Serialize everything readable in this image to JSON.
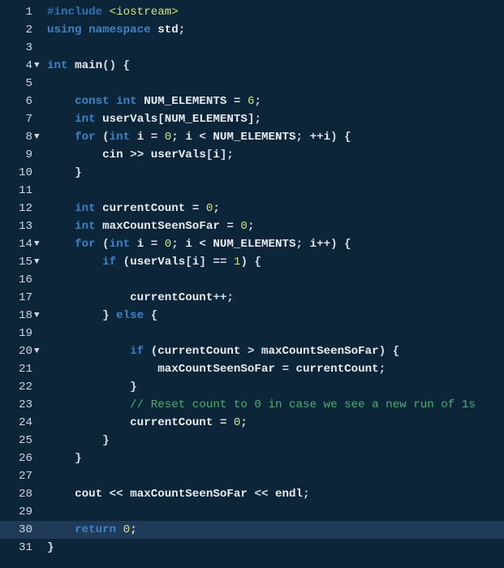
{
  "total_lines": 31,
  "fold_lines": [
    4,
    8,
    14,
    15,
    18,
    20
  ],
  "highlighted_line": 30,
  "lines": {
    "1": {
      "tokens": [
        [
          "pre",
          "#include "
        ],
        [
          "angle",
          "<iostream>"
        ]
      ]
    },
    "2": {
      "tokens": [
        [
          "kw",
          "using "
        ],
        [
          "kw",
          "namespace "
        ],
        [
          "std",
          "std"
        ],
        [
          "punc",
          ";"
        ]
      ]
    },
    "3": {
      "tokens": []
    },
    "4": {
      "tokens": [
        [
          "type",
          "int "
        ],
        [
          "id",
          "main"
        ],
        [
          "punc",
          "() "
        ],
        [
          "punc",
          "{"
        ]
      ]
    },
    "5": {
      "tokens": []
    },
    "6": {
      "tokens": [
        [
          "idn",
          "    "
        ],
        [
          "kw",
          "const "
        ],
        [
          "type",
          "int "
        ],
        [
          "id",
          "NUM_ELEMENTS"
        ],
        [
          "op",
          " = "
        ],
        [
          "num",
          "6"
        ],
        [
          "punc",
          ";"
        ]
      ]
    },
    "7": {
      "tokens": [
        [
          "idn",
          "    "
        ],
        [
          "type",
          "int "
        ],
        [
          "id",
          "userVals"
        ],
        [
          "punc",
          "["
        ],
        [
          "id",
          "NUM_ELEMENTS"
        ],
        [
          "punc",
          "];"
        ]
      ]
    },
    "8": {
      "tokens": [
        [
          "idn",
          "    "
        ],
        [
          "kw",
          "for "
        ],
        [
          "punc",
          "("
        ],
        [
          "type",
          "int "
        ],
        [
          "id",
          "i"
        ],
        [
          "op",
          " = "
        ],
        [
          "num",
          "0"
        ],
        [
          "punc",
          "; "
        ],
        [
          "id",
          "i"
        ],
        [
          "op",
          " < "
        ],
        [
          "id",
          "NUM_ELEMENTS"
        ],
        [
          "punc",
          "; "
        ],
        [
          "op",
          "++"
        ],
        [
          "id",
          "i"
        ],
        [
          "punc",
          ") {"
        ]
      ]
    },
    "9": {
      "tokens": [
        [
          "idn",
          "        "
        ],
        [
          "id",
          "cin"
        ],
        [
          "op",
          " >> "
        ],
        [
          "id",
          "userVals"
        ],
        [
          "punc",
          "["
        ],
        [
          "id",
          "i"
        ],
        [
          "punc",
          "];"
        ]
      ]
    },
    "10": {
      "tokens": [
        [
          "idn",
          "    "
        ],
        [
          "punc",
          "}"
        ]
      ]
    },
    "11": {
      "tokens": []
    },
    "12": {
      "tokens": [
        [
          "idn",
          "    "
        ],
        [
          "type",
          "int "
        ],
        [
          "id",
          "currentCount"
        ],
        [
          "op",
          " = "
        ],
        [
          "num",
          "0"
        ],
        [
          "punc",
          ";"
        ]
      ]
    },
    "13": {
      "tokens": [
        [
          "idn",
          "    "
        ],
        [
          "type",
          "int "
        ],
        [
          "id",
          "maxCountSeenSoFar"
        ],
        [
          "op",
          " = "
        ],
        [
          "num",
          "0"
        ],
        [
          "punc",
          ";"
        ]
      ]
    },
    "14": {
      "tokens": [
        [
          "idn",
          "    "
        ],
        [
          "kw",
          "for "
        ],
        [
          "punc",
          "("
        ],
        [
          "type",
          "int "
        ],
        [
          "id",
          "i"
        ],
        [
          "op",
          " = "
        ],
        [
          "num",
          "0"
        ],
        [
          "punc",
          "; "
        ],
        [
          "id",
          "i"
        ],
        [
          "op",
          " < "
        ],
        [
          "id",
          "NUM_ELEMENTS"
        ],
        [
          "punc",
          "; "
        ],
        [
          "id",
          "i"
        ],
        [
          "op",
          "++"
        ],
        [
          "punc",
          ") {"
        ]
      ]
    },
    "15": {
      "tokens": [
        [
          "idn",
          "        "
        ],
        [
          "kw",
          "if "
        ],
        [
          "punc",
          "("
        ],
        [
          "id",
          "userVals"
        ],
        [
          "punc",
          "["
        ],
        [
          "id",
          "i"
        ],
        [
          "punc",
          "]"
        ],
        [
          "op",
          " == "
        ],
        [
          "num",
          "1"
        ],
        [
          "punc",
          ") {"
        ]
      ]
    },
    "16": {
      "tokens": []
    },
    "17": {
      "tokens": [
        [
          "idn",
          "            "
        ],
        [
          "id",
          "currentCount"
        ],
        [
          "op",
          "++"
        ],
        [
          "punc",
          ";"
        ]
      ]
    },
    "18": {
      "tokens": [
        [
          "idn",
          "        "
        ],
        [
          "punc",
          "} "
        ],
        [
          "else",
          "else "
        ],
        [
          "punc",
          "{"
        ]
      ]
    },
    "19": {
      "tokens": []
    },
    "20": {
      "tokens": [
        [
          "idn",
          "            "
        ],
        [
          "kw",
          "if "
        ],
        [
          "punc",
          "("
        ],
        [
          "id",
          "currentCount"
        ],
        [
          "op",
          " > "
        ],
        [
          "id",
          "maxCountSeenSoFar"
        ],
        [
          "punc",
          ") {"
        ]
      ]
    },
    "21": {
      "tokens": [
        [
          "idn",
          "                "
        ],
        [
          "id",
          "maxCountSeenSoFar"
        ],
        [
          "op",
          " = "
        ],
        [
          "id",
          "currentCount"
        ],
        [
          "punc",
          ";"
        ]
      ]
    },
    "22": {
      "tokens": [
        [
          "idn",
          "            "
        ],
        [
          "punc",
          "}"
        ]
      ]
    },
    "23": {
      "tokens": [
        [
          "idn",
          "            "
        ],
        [
          "comm",
          "// Reset count to 0 in case we see a new run of 1s"
        ]
      ]
    },
    "24": {
      "tokens": [
        [
          "idn",
          "            "
        ],
        [
          "id",
          "currentCount"
        ],
        [
          "op",
          " = "
        ],
        [
          "num",
          "0"
        ],
        [
          "punc",
          ";"
        ]
      ]
    },
    "25": {
      "tokens": [
        [
          "idn",
          "        "
        ],
        [
          "punc",
          "}"
        ]
      ]
    },
    "26": {
      "tokens": [
        [
          "idn",
          "    "
        ],
        [
          "punc",
          "}"
        ]
      ]
    },
    "27": {
      "tokens": []
    },
    "28": {
      "tokens": [
        [
          "idn",
          "    "
        ],
        [
          "id",
          "cout"
        ],
        [
          "op",
          " << "
        ],
        [
          "id",
          "maxCountSeenSoFar"
        ],
        [
          "op",
          " << "
        ],
        [
          "id",
          "endl"
        ],
        [
          "punc",
          ";"
        ]
      ]
    },
    "29": {
      "tokens": []
    },
    "30": {
      "tokens": [
        [
          "idn",
          "    "
        ],
        [
          "kw",
          "return "
        ],
        [
          "num",
          "0"
        ],
        [
          "punc",
          ";"
        ]
      ]
    },
    "31": {
      "tokens": [
        [
          "punc",
          "}"
        ]
      ]
    }
  },
  "fold_marker": "▼"
}
